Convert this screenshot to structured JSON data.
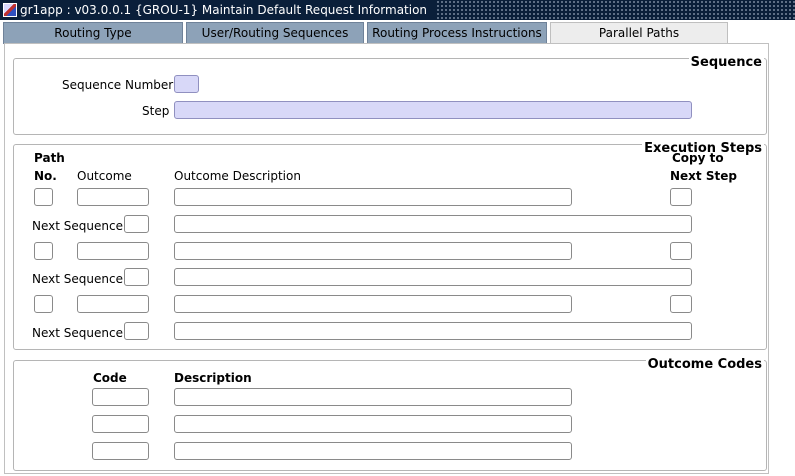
{
  "window": {
    "title": "gr1app : v03.0.0.1  {GROU-1} Maintain Default Request Information"
  },
  "tabs": [
    {
      "label": "Routing Type"
    },
    {
      "label": "User/Routing Sequences"
    },
    {
      "label": "Routing Process Instructions"
    },
    {
      "label": "Parallel Paths",
      "active": true
    }
  ],
  "sequence": {
    "title": "Sequence",
    "sequence_number_label": "Sequence Number",
    "sequence_number_value": "",
    "step_label": "Step",
    "step_value": ""
  },
  "execution": {
    "title": "Execution Steps",
    "col_path": "Path",
    "col_no": "No.",
    "col_outcome": "Outcome",
    "col_outcome_desc": "Outcome Description",
    "col_copy": "Copy to",
    "col_next_step": "Next Step",
    "next_sequence_label": "Next Sequence",
    "rows": [
      {
        "path_no": "",
        "outcome": "",
        "outcome_description": "",
        "copy_to_next": "",
        "next_sequence": "",
        "next_sequence_desc": ""
      },
      {
        "path_no": "",
        "outcome": "",
        "outcome_description": "",
        "copy_to_next": "",
        "next_sequence": "",
        "next_sequence_desc": ""
      },
      {
        "path_no": "",
        "outcome": "",
        "outcome_description": "",
        "copy_to_next": "",
        "next_sequence": "",
        "next_sequence_desc": ""
      }
    ]
  },
  "outcome_codes": {
    "title": "Outcome Codes",
    "col_code": "Code",
    "col_description": "Description",
    "rows": [
      {
        "code": "",
        "description": ""
      },
      {
        "code": "",
        "description": ""
      },
      {
        "code": "",
        "description": ""
      }
    ]
  },
  "colors": {
    "title_bar": "#0a1f3a",
    "tab_inactive": "#8da2b8",
    "tab_active": "#ededed",
    "required_field": "#d8d8f8"
  }
}
